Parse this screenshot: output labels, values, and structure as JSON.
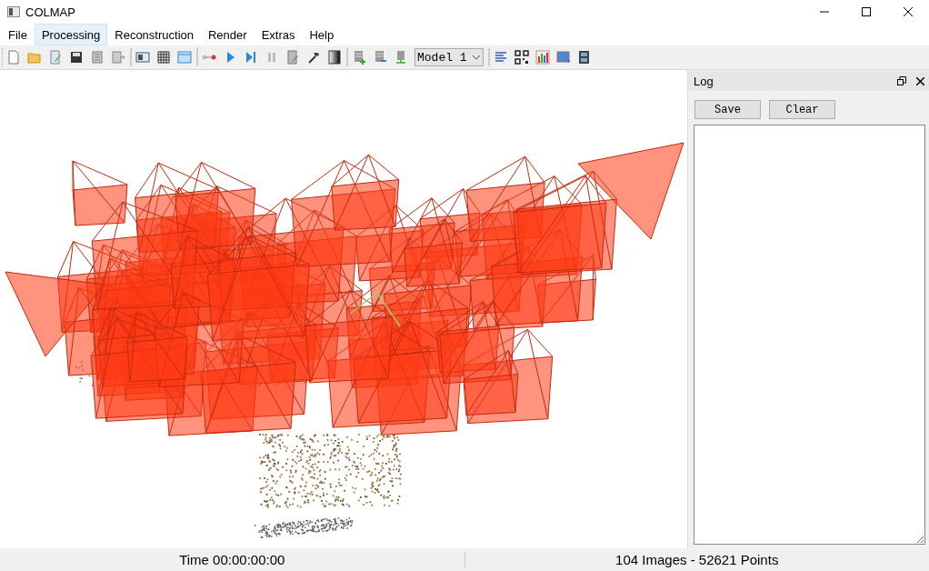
{
  "window": {
    "title": "COLMAP"
  },
  "menu": [
    {
      "label": "File",
      "highlighted": false
    },
    {
      "label": "Processing",
      "highlighted": true
    },
    {
      "label": "Reconstruction",
      "highlighted": false
    },
    {
      "label": "Render",
      "highlighted": false
    },
    {
      "label": "Extras",
      "highlighted": false
    },
    {
      "label": "Help",
      "highlighted": false
    }
  ],
  "toolbar": {
    "model_select": {
      "value": "Model 1"
    }
  },
  "log_panel": {
    "title": "Log",
    "buttons": [
      "Save",
      "Clear"
    ]
  },
  "status_bar": {
    "time": "Time 00:00:00:00",
    "summary": "104 Images - 52621 Points"
  }
}
